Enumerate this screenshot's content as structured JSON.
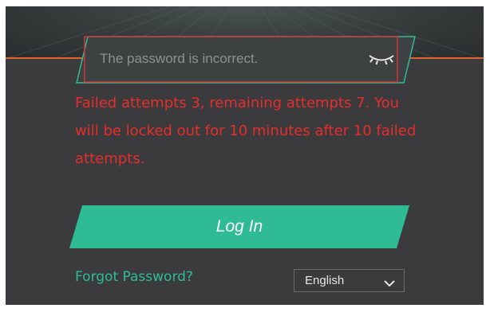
{
  "login": {
    "password_placeholder": "The password is incorrect.",
    "password_value": "",
    "error_message": "Failed attempts 3, remaining attempts 7. You will be locked out for 10 minutes after 10 failed attempts.",
    "login_button_label": "Log In",
    "forgot_password_label": "Forgot Password?",
    "language": {
      "selected": "English"
    }
  },
  "icons": {
    "password_visibility": "eye-closed-icon",
    "language_dropdown": "chevron-down-icon"
  },
  "colors": {
    "panel_background": "#3b3b3d",
    "header_accent": "#e0632b",
    "error_red": "#e42d2d",
    "input_error_border": "#d23434",
    "input_focus_border": "#2ebd93",
    "button_teal": "#2fbc94",
    "link_teal": "#2ebd93"
  }
}
